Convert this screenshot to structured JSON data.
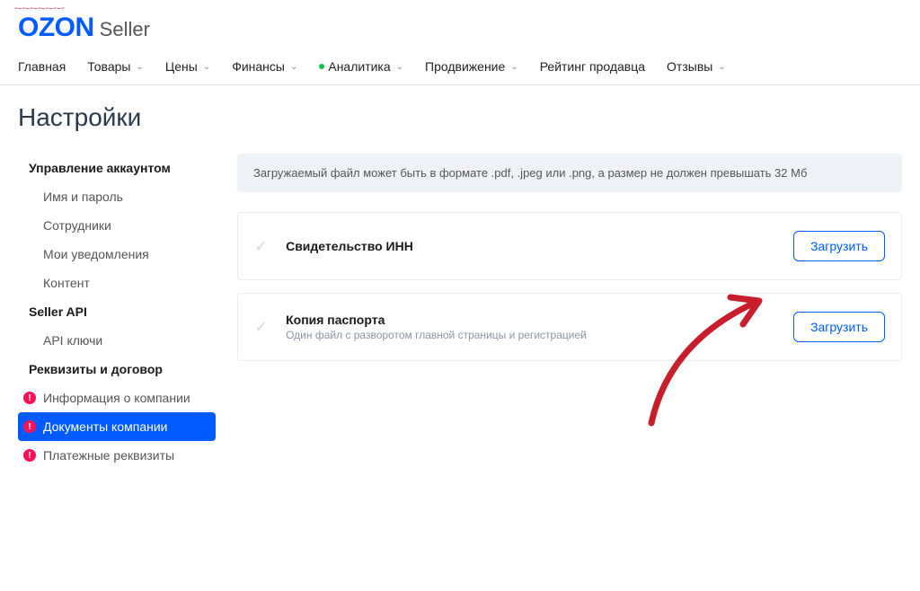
{
  "logo": {
    "brand": "OZON",
    "suffix": "Seller"
  },
  "nav": [
    {
      "label": "Главная",
      "dropdown": false
    },
    {
      "label": "Товары",
      "dropdown": true
    },
    {
      "label": "Цены",
      "dropdown": true
    },
    {
      "label": "Финансы",
      "dropdown": true
    },
    {
      "label": "Аналитика",
      "dropdown": true,
      "dot": true
    },
    {
      "label": "Продвижение",
      "dropdown": true
    },
    {
      "label": "Рейтинг продавца",
      "dropdown": false
    },
    {
      "label": "Отзывы",
      "dropdown": true
    }
  ],
  "page_title": "Настройки",
  "sidebar": {
    "sections": [
      {
        "title": "Управление аккаунтом",
        "items": [
          {
            "label": "Имя и пароль"
          },
          {
            "label": "Сотрудники"
          },
          {
            "label": "Мои уведомления"
          },
          {
            "label": "Контент"
          }
        ]
      },
      {
        "title": "Seller API",
        "items": [
          {
            "label": "API ключи"
          }
        ]
      },
      {
        "title": "Реквизиты и договор",
        "items": [
          {
            "label": "Информация о компании",
            "alert": true
          },
          {
            "label": "Документы компании",
            "alert": true,
            "active": true
          },
          {
            "label": "Платежные реквизиты",
            "alert": true
          }
        ]
      }
    ]
  },
  "banner": "Загружаемый файл может быть в формате .pdf, .jpeg или .png, а размер не должен превышать 32 Мб",
  "documents": [
    {
      "title": "Свидетельство ИНН",
      "sub": "",
      "button": "Загрузить"
    },
    {
      "title": "Копия паспорта",
      "sub": "Один файл с разворотом главной страницы и регистрацией",
      "button": "Загрузить"
    }
  ]
}
